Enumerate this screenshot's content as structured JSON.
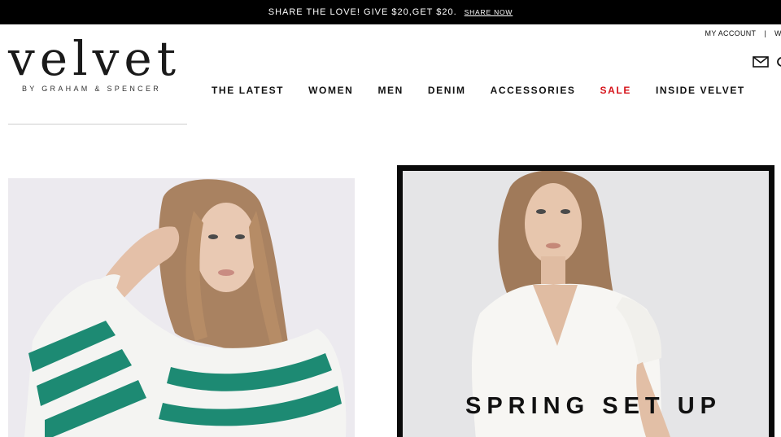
{
  "promo": {
    "text": "SHARE THE LOVE! GIVE $20,GET $20.",
    "link": "SHARE NOW"
  },
  "utility": {
    "account": "MY ACCOUNT",
    "separator": "|",
    "wishlist_clipped": "W"
  },
  "icons": [
    "mail-icon",
    "search-icon"
  ],
  "logo": {
    "wordmark": "velvet",
    "tagline": "BY GRAHAM & SPENCER"
  },
  "nav": {
    "items": [
      {
        "label": "THE LATEST"
      },
      {
        "label": "WOMEN"
      },
      {
        "label": "MEN"
      },
      {
        "label": "DENIM"
      },
      {
        "label": "ACCESSORIES"
      },
      {
        "label": "SALE",
        "color": "#d6141b"
      },
      {
        "label": "INSIDE VELVET"
      }
    ]
  },
  "hero": {
    "right_caption": "SPRING SET UP"
  },
  "colors": {
    "promo_bg": "#000000",
    "sale": "#d6141b",
    "stripe_green": "#1d8a73"
  }
}
